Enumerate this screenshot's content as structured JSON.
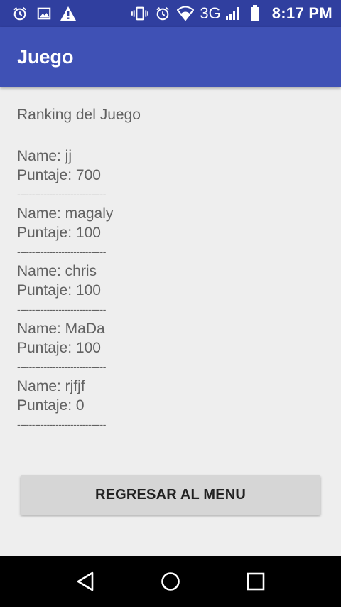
{
  "status_bar": {
    "network": "3G",
    "time": "8:17 PM",
    "left_icons": [
      "alarm-icon",
      "image-icon",
      "warning-icon"
    ],
    "right_icons": [
      "vibrate-icon",
      "alarm-icon",
      "wifi-icon",
      "signal-icon",
      "battery-icon"
    ]
  },
  "app_bar": {
    "title": "Juego",
    "color": "#3f51b5",
    "status_color": "#303f9f"
  },
  "ranking": {
    "heading": "Ranking del Juego",
    "separator": "------------------------------",
    "entries": [
      {
        "name_line": "Name: jj",
        "score_line": "Puntaje: 700"
      },
      {
        "name_line": "Name: magaly",
        "score_line": "Puntaje: 100"
      },
      {
        "name_line": "Name: chris",
        "score_line": "Puntaje: 100"
      },
      {
        "name_line": "Name: MaDa",
        "score_line": "Puntaje: 100"
      },
      {
        "name_line": "Name: rjfjf",
        "score_line": "Puntaje: 0"
      }
    ]
  },
  "back_button": {
    "label": "REGRESAR AL MENU"
  },
  "nav_bar": {
    "buttons": [
      "back-icon",
      "home-icon",
      "recents-icon"
    ]
  }
}
